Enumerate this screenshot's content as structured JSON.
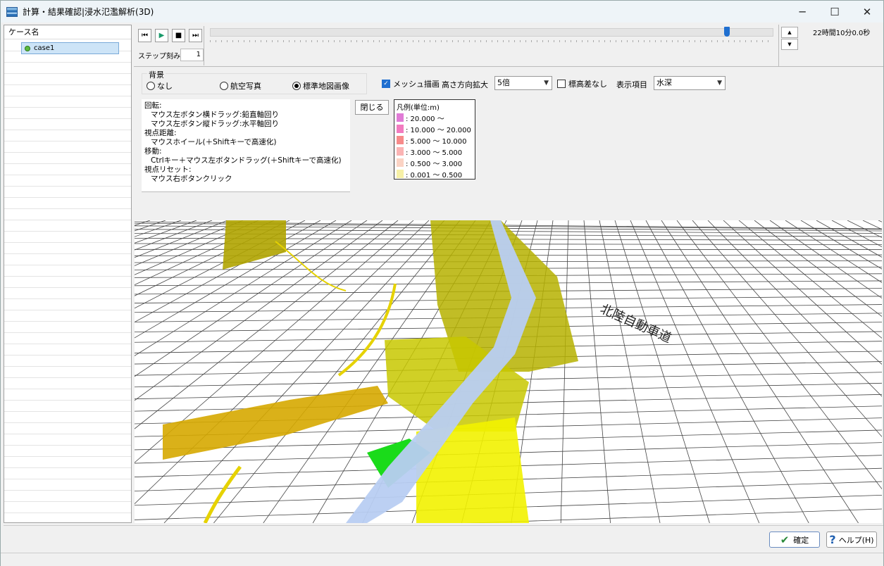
{
  "window": {
    "title": "計算・結果確認|浸水氾濫解析(3D)"
  },
  "sidebar": {
    "header": "ケース名",
    "cases": [
      {
        "label": "case1"
      }
    ]
  },
  "playback": {
    "step_label": "ステップ刻み",
    "step_value": "1",
    "time_display": "22時間10分0.0秒",
    "progress_fraction": 0.92
  },
  "background": {
    "group_label": "背景",
    "options": [
      {
        "label": "なし",
        "selected": false
      },
      {
        "label": "航空写真",
        "selected": false
      },
      {
        "label": "標準地図画像",
        "selected": true
      }
    ]
  },
  "display": {
    "mesh_label": "メッシュ描画",
    "mesh_checked": true,
    "height_scale_label": "高さ方向拡大",
    "height_scale_value": "5倍",
    "no_elevation_label": "標高差なし",
    "no_elevation_checked": false,
    "item_label": "表示項目",
    "item_value": "水深"
  },
  "help": {
    "rotate_title": "回転:",
    "rotate_1": "マウス左ボタン横ドラッグ:鉛直軸回り",
    "rotate_2": "マウス左ボタン縦ドラッグ:水平軸回り",
    "distance_title": "視点距離:",
    "distance_1": "マウスホイール(＋Shiftキーで高速化)",
    "move_title": "移動:",
    "move_1": "Ctrlキー＋マウス左ボタンドラッグ(＋Shiftキーで高速化)",
    "reset_title": "視点リセット:",
    "reset_1": "マウス右ボタンクリック",
    "close_label": "閉じる"
  },
  "legend": {
    "title": "凡例(単位:m)",
    "items": [
      {
        "label": ": 20.000 ～",
        "color": "#e07bd6"
      },
      {
        "label": ": 10.000 ～ 20.000",
        "color": "#f27bbf"
      },
      {
        "label": ":  5.000 ～ 10.000",
        "color": "#f78a8a"
      },
      {
        "label": ":  3.000 ～  5.000",
        "color": "#fbb4b4"
      },
      {
        "label": ":  0.500 ～  3.000",
        "color": "#fbd3c4"
      },
      {
        "label": ":  0.001 ～  0.500",
        "color": "#f6f0a6"
      }
    ]
  },
  "map": {
    "label": "北陸自動車道"
  },
  "buttons": {
    "ok_label": "確定",
    "help_label": "ヘルプ(H)"
  }
}
